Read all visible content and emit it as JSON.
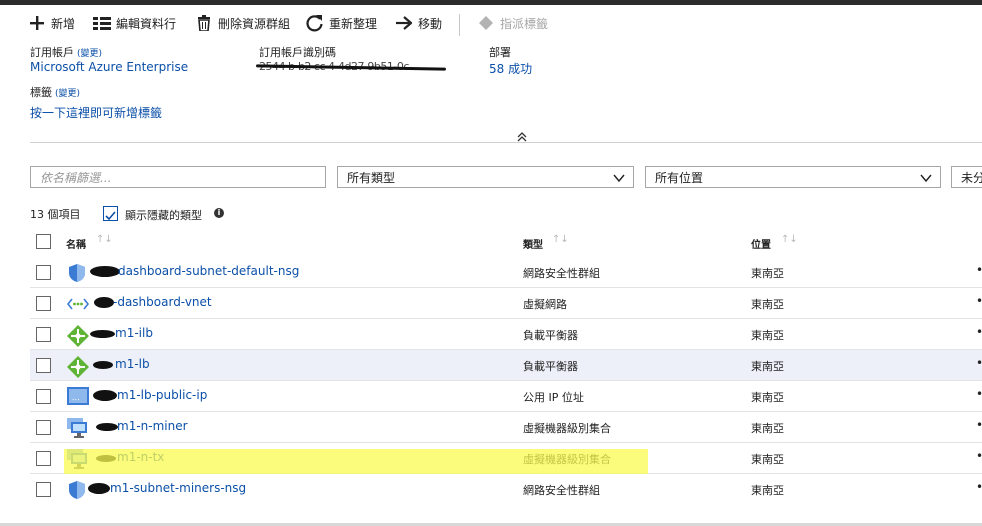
{
  "toolbar": {
    "add": "新增",
    "edit_columns": "編輯資料行",
    "delete_group": "刪除資源群組",
    "refresh": "重新整理",
    "move": "移動",
    "assign_tags": "指派標籤"
  },
  "essentials": {
    "subscription_label": "訂用帳戶",
    "subscription_change": "(變更)",
    "subscription_value": "Microsoft Azure Enterprise",
    "subscription_id_label": "訂用帳戶識別碼",
    "subscription_id_value": "2544 b-b2 cc 4-4d27-9b51-0c...",
    "deployments_label": "部署",
    "deployments_value": "58 成功",
    "tags_label": "標籤",
    "tags_change": "(變更)",
    "tags_link": "按一下這裡即可新增標籤"
  },
  "filters": {
    "name_placeholder": "依名稱篩選...",
    "type_value": "所有類型",
    "location_value": "所有位置",
    "group_value": "未分"
  },
  "list": {
    "count": "13 個項目",
    "show_hidden": "顯示隱藏的類型",
    "info": "i",
    "columns": {
      "name": "名稱",
      "type": "類型",
      "location": "位置"
    },
    "sort_glyph": "↑↓",
    "more_glyph": "•",
    "rows": [
      {
        "name": "dashboard-subnet-default-nsg",
        "type": "網路安全性群組",
        "location": "東南亞",
        "icon": "nsg-shield-icon"
      },
      {
        "name": "-dashboard-vnet",
        "type": "虛擬網路",
        "location": "東南亞",
        "icon": "vnet-icon"
      },
      {
        "name": "m1-ilb",
        "type": "負載平衡器",
        "location": "東南亞",
        "icon": "load-balancer-icon"
      },
      {
        "name": "m1-lb",
        "type": "負載平衡器",
        "location": "東南亞",
        "icon": "load-balancer-icon"
      },
      {
        "name": "m1-lb-public-ip",
        "type": "公用 IP 位址",
        "location": "東南亞",
        "icon": "public-ip-icon"
      },
      {
        "name": "m1-n-miner",
        "type": "虛擬機器級別集合",
        "location": "東南亞",
        "icon": "vmss-icon"
      },
      {
        "name": "m1-n-tx",
        "type": "虛擬機器級別集合",
        "location": "東南亞",
        "icon": "vmss-icon"
      },
      {
        "name": "m1-subnet-miners-nsg",
        "type": "網路安全性群組",
        "location": "東南亞",
        "icon": "nsg-shield-icon"
      }
    ]
  },
  "colors": {
    "link": "#0b4fa8",
    "hover_row": "#edf0f8",
    "highlighter": "#fafa50"
  }
}
